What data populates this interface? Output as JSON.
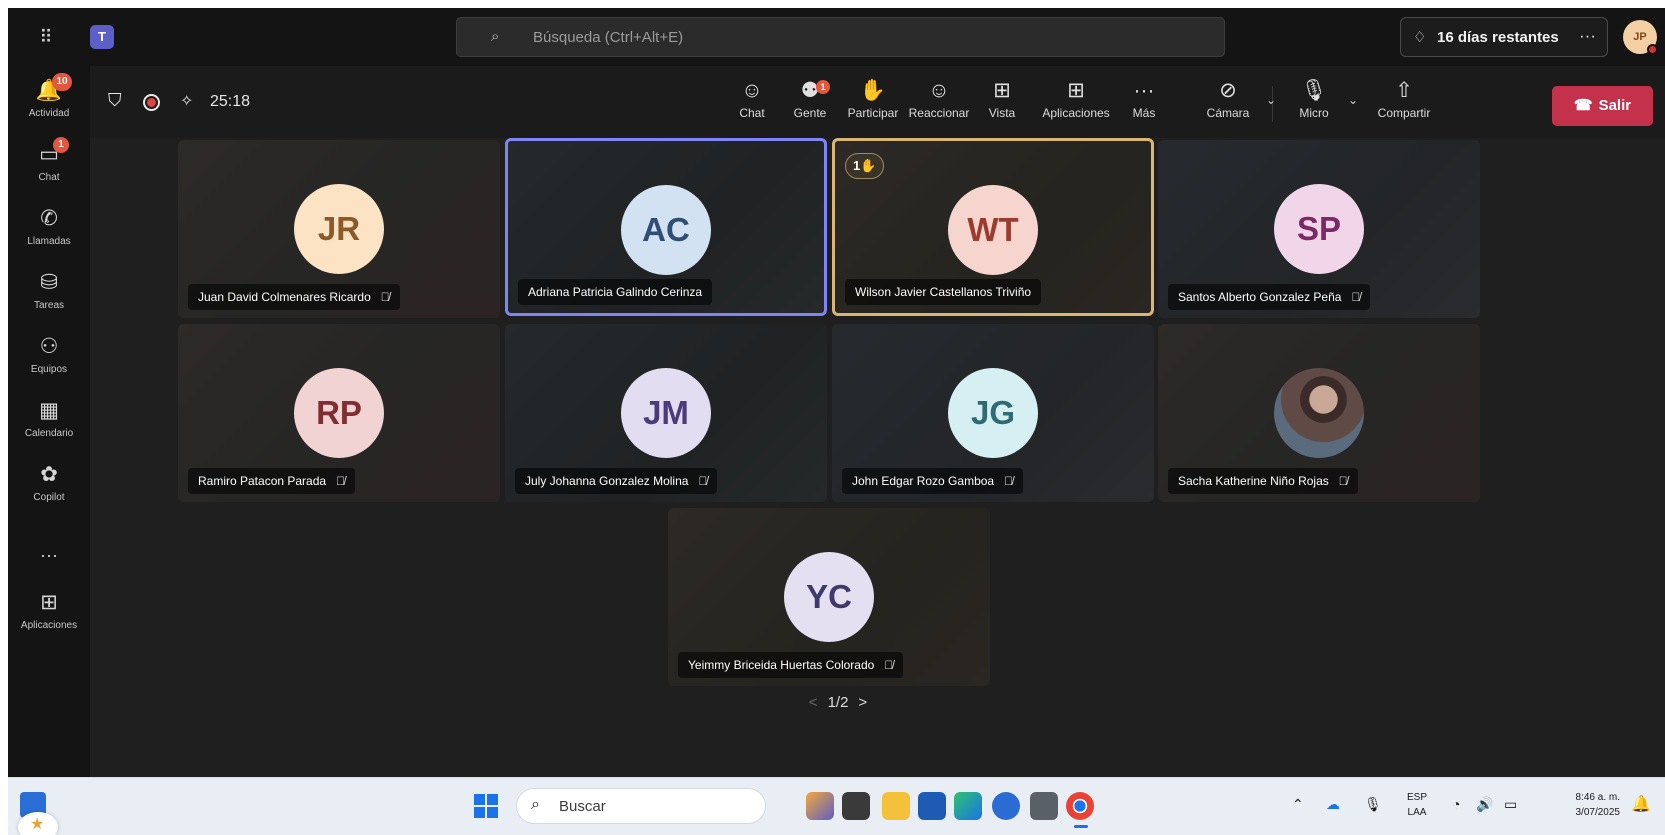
{
  "titlebar": {
    "search_placeholder": "Búsqueda (Ctrl+Alt+E)",
    "trial_label": "16 días restantes",
    "trial_more": "···",
    "user_initials": "JP"
  },
  "rail": [
    {
      "label": "Actividad",
      "icon": "bell-icon",
      "glyph": "🔔",
      "badge": "10"
    },
    {
      "label": "Chat",
      "icon": "chat-icon",
      "glyph": "💬",
      "badge": "1"
    },
    {
      "label": "Llamadas",
      "icon": "phone-icon",
      "glyph": "☏",
      "badge": ""
    },
    {
      "label": "Tareas",
      "icon": "tasks-icon",
      "glyph": "⛁",
      "badge": ""
    },
    {
      "label": "Equipos",
      "icon": "teams-icon",
      "glyph": "⚇",
      "badge": ""
    },
    {
      "label": "Calendario",
      "icon": "calendar-icon",
      "glyph": "▦",
      "badge": ""
    },
    {
      "label": "Copilot",
      "icon": "copilot-icon",
      "glyph": "✿",
      "badge": ""
    },
    {
      "label": "Aplicaciones",
      "icon": "add-apps-icon",
      "glyph": "⊞",
      "badge": ""
    }
  ],
  "rail_more": "···",
  "meeting": {
    "elapsed": "25:18",
    "tools": {
      "chat": "Chat",
      "people": "Gente",
      "people_badge": "1",
      "raise": "Participar",
      "react": "Reaccionar",
      "view": "Vista",
      "apps": "Aplicaciones",
      "more": "Más",
      "camera": "Cámara",
      "mic": "Micro",
      "share": "Compartir",
      "leave": "Salir"
    }
  },
  "participants": [
    {
      "initials": "JR",
      "name": "Juan David Colmenares Ricardo",
      "muted": true,
      "bg": "#fbe3c4",
      "fg": "#8a5a2b"
    },
    {
      "initials": "AC",
      "name": "Adriana Patricia Galindo Cerinza",
      "muted": false,
      "bg": "#d3e2f2",
      "fg": "#2f4e73"
    },
    {
      "initials": "WT",
      "name": "Wilson Javier Castellanos Triviño",
      "muted": false,
      "bg": "#f6d5cf",
      "fg": "#9a3b2e",
      "hand": "1✋"
    },
    {
      "initials": "SP",
      "name": "Santos Alberto Gonzalez Peña",
      "muted": true,
      "bg": "#f1d6ea",
      "fg": "#7b2a63"
    },
    {
      "initials": "RP",
      "name": "Ramiro Patacon Parada",
      "muted": true,
      "bg": "#f2d3d3",
      "fg": "#7f2e31"
    },
    {
      "initials": "JM",
      "name": "July Johanna Gonzalez Molina",
      "muted": true,
      "bg": "#e2ddf0",
      "fg": "#4a3c7a"
    },
    {
      "initials": "JG",
      "name": "John Edgar Rozo Gamboa",
      "muted": true,
      "bg": "#d6eff2",
      "fg": "#2e6b72"
    },
    {
      "initials": "",
      "name": "Sacha Katherine Niño Rojas",
      "muted": true,
      "photo": true
    },
    {
      "initials": "YC",
      "name": "Yeimmy Briceida Huertas Colorado",
      "muted": true,
      "bg": "#e4e0f1",
      "fg": "#3f3a6a"
    }
  ],
  "pager": {
    "label": "1/2",
    "prev": "<",
    "next": ">"
  },
  "taskbar": {
    "search": "Buscar",
    "lang_top": "ESP",
    "lang_bottom": "LAA",
    "time": "8:46 a. m.",
    "date": "3/07/2025"
  },
  "colors": {
    "accent": "#7f85f5",
    "leave": "#c4314b",
    "badge": "#e3573f",
    "raised_hand_border": "#d9b674"
  }
}
